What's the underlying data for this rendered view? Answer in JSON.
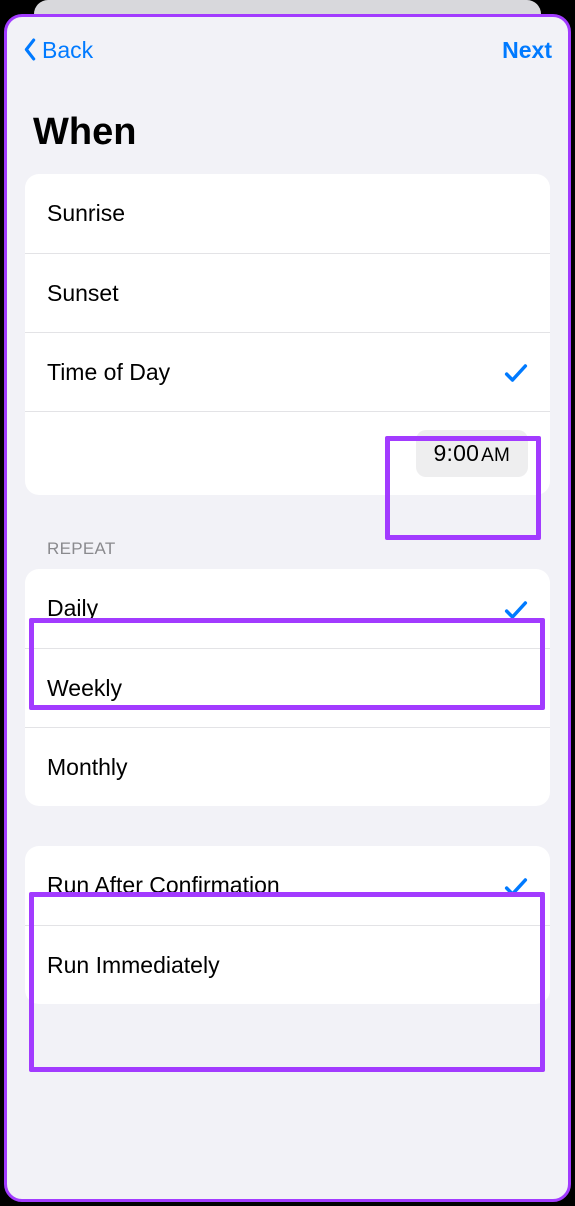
{
  "nav": {
    "back": "Back",
    "next": "Next"
  },
  "title": "When",
  "when": {
    "options": {
      "sunrise": "Sunrise",
      "sunset": "Sunset",
      "timeofday": "Time of Day"
    },
    "time_value": "9:00",
    "time_ampm": "AM"
  },
  "repeat": {
    "header": "REPEAT",
    "options": {
      "daily": "Daily",
      "weekly": "Weekly",
      "monthly": "Monthly"
    }
  },
  "run": {
    "options": {
      "confirm": "Run After Confirmation",
      "immediate": "Run Immediately"
    }
  }
}
